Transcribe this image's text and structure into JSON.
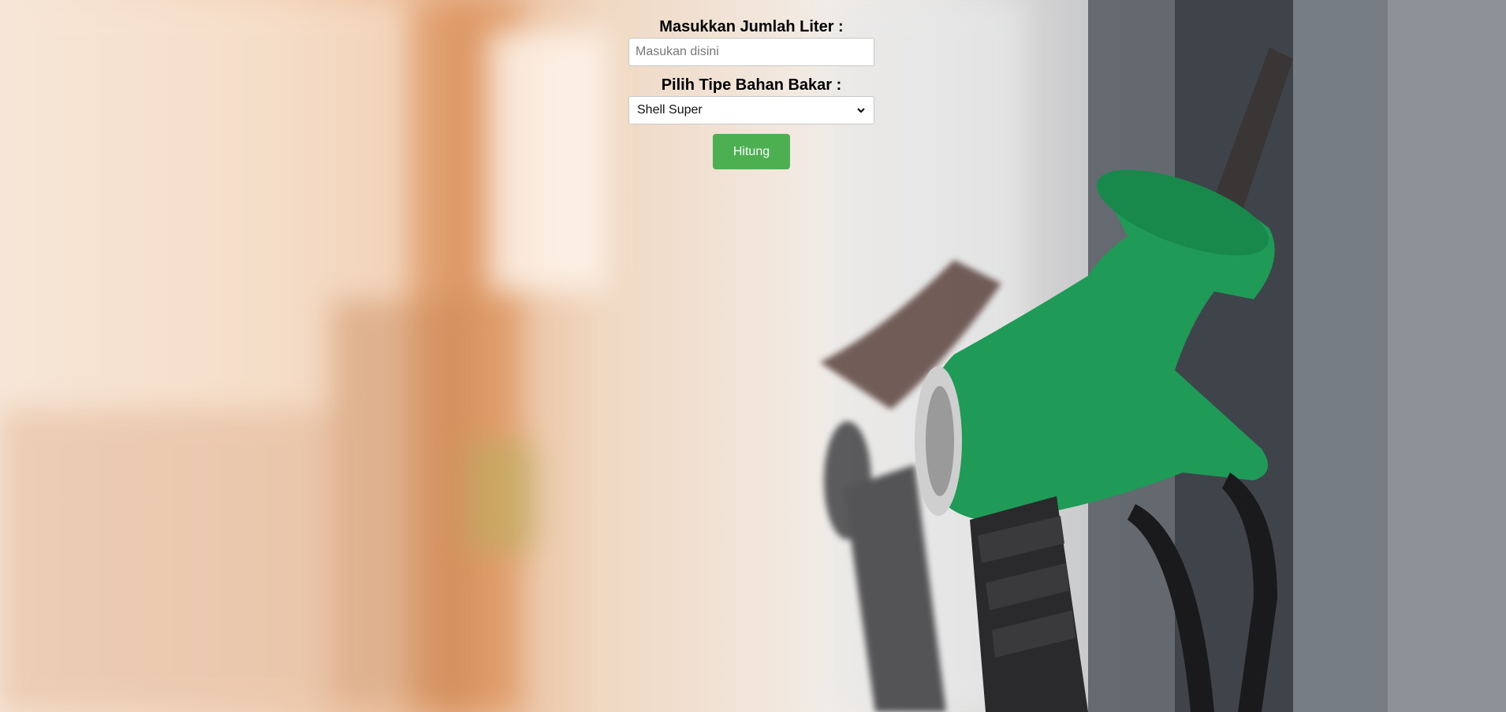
{
  "form": {
    "liters_label": "Masukkan Jumlah Liter :",
    "liters_placeholder": "Masukan disini",
    "liters_value": "",
    "fuel_label": "Pilih Tipe Bahan Bakar :",
    "fuel_selected": "Shell Super",
    "submit_label": "Hitung"
  },
  "colors": {
    "button": "#4caf50",
    "nozzle": "#1f9a57"
  },
  "background": {
    "icon": "fuel-pump-nozzle-photo"
  }
}
